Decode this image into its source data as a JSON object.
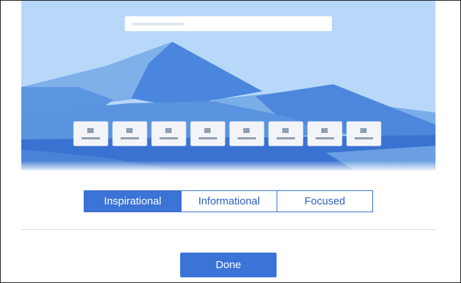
{
  "colors": {
    "accent": "#3b73d6",
    "sky": "#b7d8f9",
    "mountain_light": "#7aaee9",
    "mountain_mid": "#4d87dc",
    "mountain_dark": "#3a6fcf",
    "water": "#3a72d1",
    "tile_background": "#f2f4f7",
    "divider": "#d9d9d9"
  },
  "preview": {
    "description_icon": "landscape-background",
    "tile_count": 8
  },
  "layout_options": {
    "selected": "Inspirational",
    "options": [
      {
        "label": "Inspirational"
      },
      {
        "label": "Informational"
      },
      {
        "label": "Focused"
      }
    ]
  },
  "footer": {
    "done_label": "Done"
  }
}
